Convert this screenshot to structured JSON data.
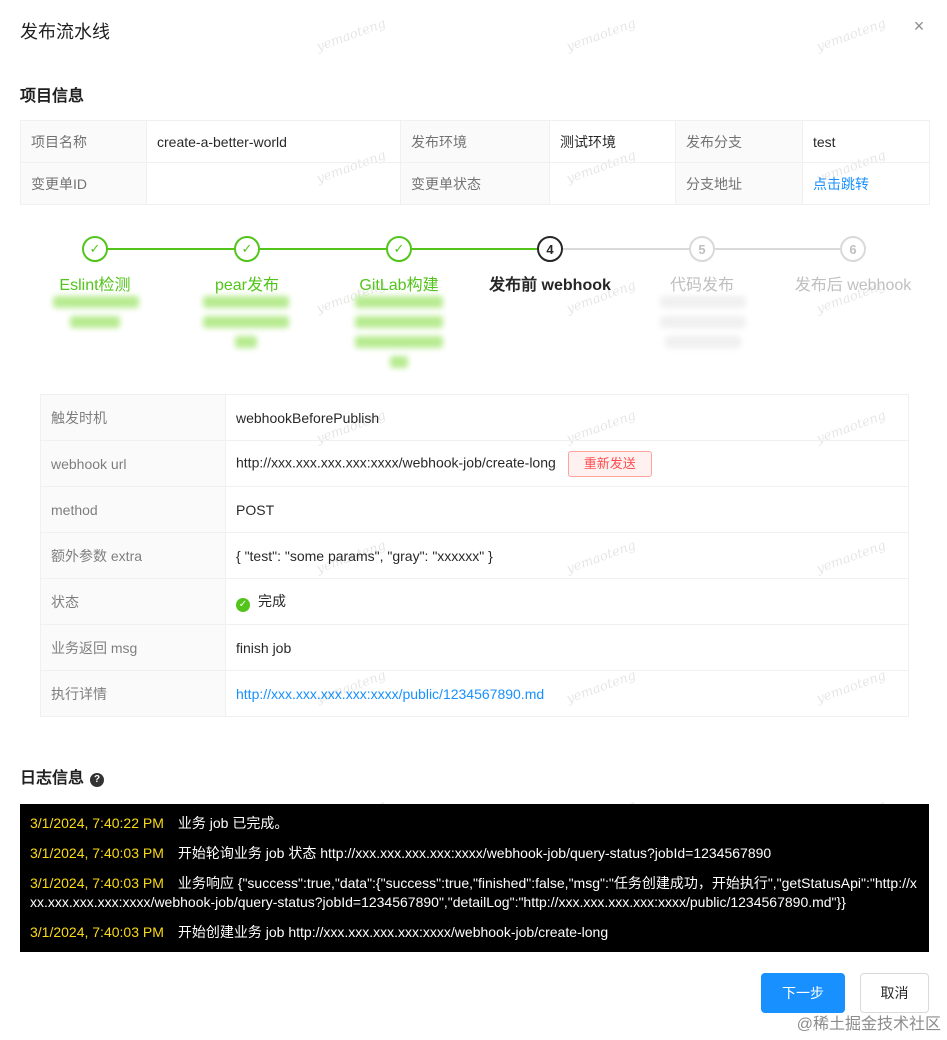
{
  "modal": {
    "title": "发布流水线",
    "close_symbol": "×"
  },
  "project": {
    "section_title": "项目信息",
    "rows": [
      [
        {
          "label": "项目名称",
          "value": "create-a-better-world"
        },
        {
          "label": "发布环境",
          "value": "测试环境"
        },
        {
          "label": "发布分支",
          "value": "test"
        }
      ],
      [
        {
          "label": "变更单ID",
          "value": ""
        },
        {
          "label": "变更单状态",
          "value": ""
        },
        {
          "label": "分支地址",
          "value": "点击跳转"
        }
      ]
    ]
  },
  "steps": [
    {
      "label": "Eslint检测",
      "status": "done",
      "number": "1"
    },
    {
      "label": "pear发布",
      "status": "done",
      "number": "2"
    },
    {
      "label": "GitLab构建",
      "status": "done",
      "number": "3"
    },
    {
      "label": "发布前 webhook",
      "status": "current",
      "number": "4"
    },
    {
      "label": "代码发布",
      "status": "wait",
      "number": "5"
    },
    {
      "label": "发布后 webhook",
      "status": "wait",
      "number": "6"
    }
  ],
  "detail": {
    "rows": [
      {
        "label": "触发时机",
        "value": "webhookBeforePublish"
      },
      {
        "label": "webhook url",
        "value": "http://xxx.xxx.xxx.xxx:xxxx/webhook-job/create-long",
        "action": "重新发送"
      },
      {
        "label": "method",
        "value": "POST"
      },
      {
        "label": "额外参数 extra",
        "value": "{ \"test\": \"some params\", \"gray\": \"xxxxxx\" }"
      },
      {
        "label": "状态",
        "value": "完成"
      },
      {
        "label": "业务返回 msg",
        "value": "finish job"
      },
      {
        "label": "执行详情",
        "value": "http://xxx.xxx.xxx.xxx:xxxx/public/1234567890.md"
      }
    ]
  },
  "log": {
    "section_title": "日志信息",
    "entries": [
      {
        "time": "3/1/2024, 7:40:22 PM",
        "message": "业务 job 已完成。"
      },
      {
        "time": "3/1/2024, 7:40:03 PM",
        "message": "开始轮询业务 job 状态 http://xxx.xxx.xxx.xxx:xxxx/webhook-job/query-status?jobId=1234567890"
      },
      {
        "time": "3/1/2024, 7:40:03 PM",
        "message": "业务响应 {\"success\":true,\"data\":{\"success\":true,\"finished\":false,\"msg\":\"任务创建成功，开始执行\",\"getStatusApi\":\"http://xxx.xxx.xxx.xxx:xxxx/webhook-job/query-status?jobId=1234567890\",\"detailLog\":\"http://xxx.xxx.xxx.xxx:xxxx/public/1234567890.md\"}}"
      },
      {
        "time": "3/1/2024, 7:40:03 PM",
        "message": "开始创建业务 job http://xxx.xxx.xxx.xxx:xxxx/webhook-job/create-long"
      }
    ]
  },
  "footer": {
    "next_label": "下一步",
    "cancel_label": "取消"
  },
  "watermark_text": "yemaoteng",
  "corner_mark": "@稀土掘金技术社区",
  "colors": {
    "primary": "#1890ff",
    "success": "#52c41a",
    "danger": "#ff4d4f",
    "log_time": "#fadb14"
  }
}
